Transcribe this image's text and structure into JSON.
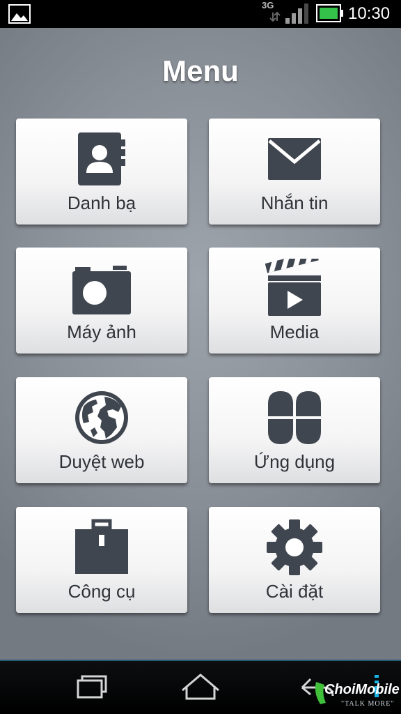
{
  "status_bar": {
    "network": "3G",
    "time": "10:30"
  },
  "page": {
    "title": "Menu"
  },
  "tiles": [
    {
      "label": "Danh bạ",
      "icon": "contacts-icon"
    },
    {
      "label": "Nhắn tin",
      "icon": "envelope-icon"
    },
    {
      "label": "Máy ảnh",
      "icon": "camera-icon"
    },
    {
      "label": "Media",
      "icon": "clapperboard-icon"
    },
    {
      "label": "Duyệt web",
      "icon": "globe-icon"
    },
    {
      "label": "Ứng dụng",
      "icon": "apps-icon"
    },
    {
      "label": "Công cụ",
      "icon": "toolbox-icon"
    },
    {
      "label": "Cài đặt",
      "icon": "gear-icon"
    }
  ],
  "nav_bar": {
    "buttons": [
      "recent-apps",
      "home",
      "back"
    ]
  },
  "watermark": {
    "brand": "ChoiMobile",
    "tagline": "\"TALK MORE\""
  },
  "colors": {
    "icon": "#40464f",
    "label": "#2f3338",
    "title": "#ffffff"
  }
}
